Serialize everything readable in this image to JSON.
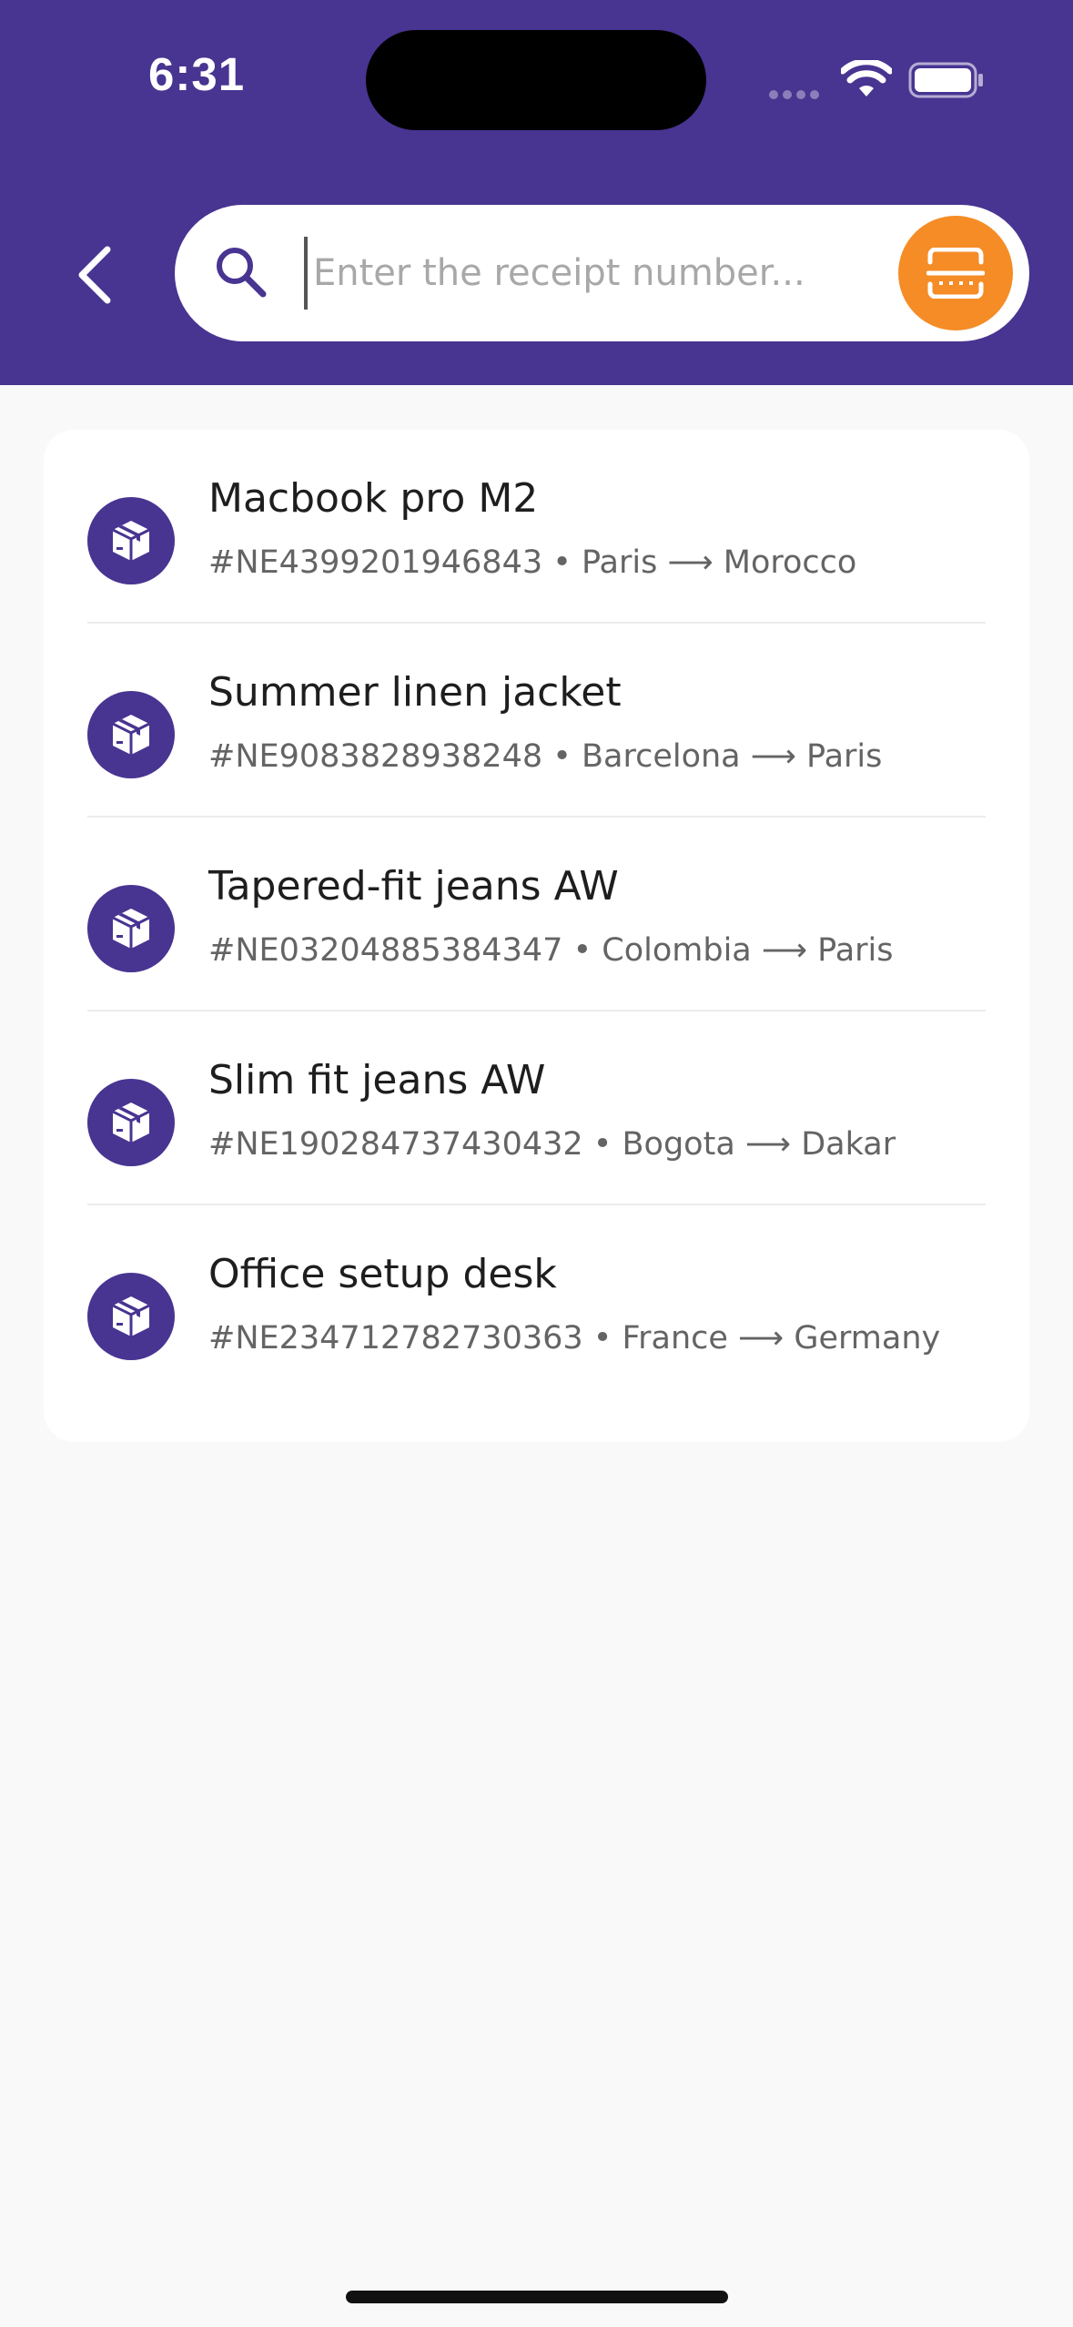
{
  "status_bar": {
    "time": "6:31"
  },
  "header": {
    "back_icon": "chevron-left-icon",
    "search": {
      "placeholder": "Enter the receipt number...",
      "value": ""
    },
    "scan_icon": "barcode-scan-icon"
  },
  "colors": {
    "primary": "#483491",
    "accent": "#f58c26",
    "background": "#f9f9f9"
  },
  "shipments": [
    {
      "icon": "package-icon",
      "name": "Macbook pro M2",
      "details": "#NE4399201946843 • Paris ⟶ Morocco"
    },
    {
      "icon": "package-icon",
      "name": "Summer linen jacket",
      "details": "#NE9083828938248 • Barcelona ⟶ Paris"
    },
    {
      "icon": "package-icon",
      "name": "Tapered-fit jeans AW",
      "details": "#NE03204885384347 • Colombia ⟶ Paris"
    },
    {
      "icon": "package-icon",
      "name": "Slim fit jeans AW",
      "details": "#NE190284737430432 • Bogota ⟶ Dakar"
    },
    {
      "icon": "package-icon",
      "name": "Office setup desk",
      "details": "#NE234712782730363 • France ⟶ Germany"
    }
  ]
}
